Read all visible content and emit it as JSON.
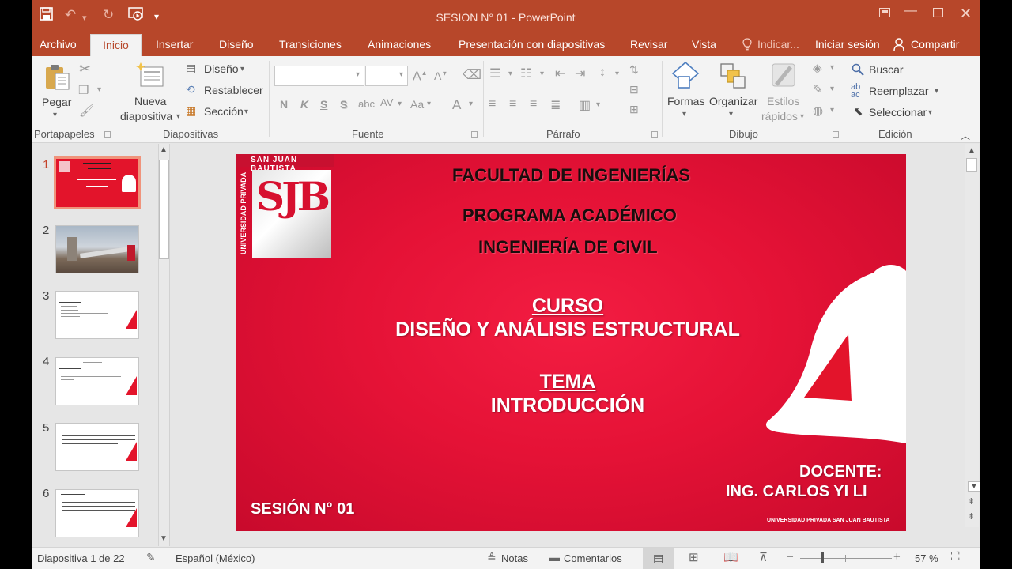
{
  "window": {
    "title": "SESION N° 01 - PowerPoint"
  },
  "tabs": {
    "archivo": "Archivo",
    "inicio": "Inicio",
    "insertar": "Insertar",
    "diseno": "Diseño",
    "transiciones": "Transiciones",
    "animaciones": "Animaciones",
    "presentacion": "Presentación con diapositivas",
    "revisar": "Revisar",
    "vista": "Vista",
    "indicar": "Indicar...",
    "iniciar_sesion": "Iniciar sesión",
    "compartir": "Compartir"
  },
  "ribbon": {
    "pegar": "Pegar",
    "portapapeles": "Portapapeles",
    "nueva1": "Nueva",
    "nueva2": "diapositiva",
    "diseno": "Diseño",
    "restablecer": "Restablecer",
    "seccion": "Sección",
    "diapositivas": "Diapositivas",
    "fuente": "Fuente",
    "font_n": "N",
    "font_k": "K",
    "font_s": "S",
    "font_s2": "S",
    "font_abc": "abc",
    "font_av": "AV",
    "font_aa": "Aa",
    "parrafo": "Párrafo",
    "formas": "Formas",
    "organizar": "Organizar",
    "estilos1": "Estilos",
    "estilos2": "rápidos",
    "dibujo": "Dibujo",
    "buscar": "Buscar",
    "reemplazar": "Reemplazar",
    "seleccionar": "Seleccionar",
    "edicion": "Edición"
  },
  "thumbnails": {
    "numbers": [
      "1",
      "2",
      "3",
      "4",
      "5",
      "6"
    ]
  },
  "slide": {
    "logo_text": "SAN JUAN BAUTISTA",
    "logo_vertical": "UNIVERSIDAD PRIVADA",
    "logo_mark": "SJB",
    "facultad": "FACULTAD DE INGENIERÍAS",
    "programa": "PROGRAMA ACADÉMICO",
    "ingenieria": "INGENIERÍA DE CIVIL",
    "curso_label": "CURSO",
    "curso_name": "DISEÑO Y ANÁLISIS ESTRUCTURAL",
    "tema_label": "TEMA",
    "tema_name": "INTRODUCCIÓN",
    "docente_label": "DOCENTE:",
    "docente_name": "ING. CARLOS YI LI",
    "sesion": "SESIÓN N° 01",
    "footer": "UNIVERSIDAD PRIVADA SAN JUAN BAUTISTA"
  },
  "status": {
    "slide_info": "Diapositiva 1 de 22",
    "language": "Español (México)",
    "notas": "Notas",
    "comentarios": "Comentarios",
    "zoom": "57 %"
  },
  "colors": {
    "accent": "#b7472a",
    "slide_red": "#e51236"
  }
}
